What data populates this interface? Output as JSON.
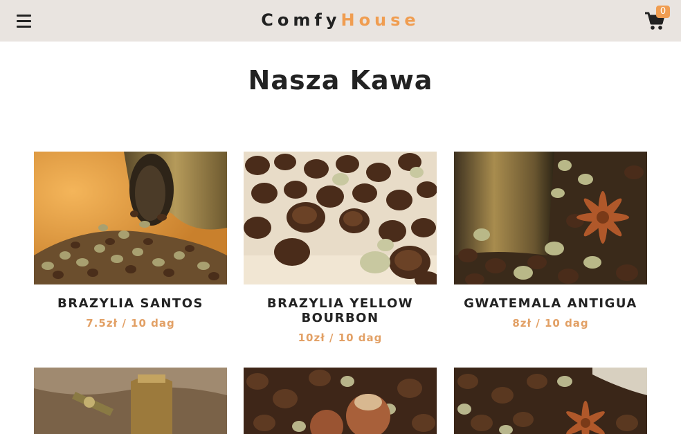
{
  "navbar": {
    "logo_part1": "Comfy",
    "logo_part2": "House",
    "cart_count": "0",
    "menu_icon": "hamburger-menu-icon",
    "cart_icon": "shopping-cart-icon"
  },
  "section": {
    "title": "Nasza Kawa"
  },
  "products": [
    {
      "name": "BRAZYLIA SANTOS",
      "price": "7.5zł / 10 dag"
    },
    {
      "name": "BRAZYLIA YELLOW BOURBON",
      "price": "10zł / 10 dag"
    },
    {
      "name": "GWATEMALA ANTIGUA",
      "price": "8zł / 10 dag"
    }
  ],
  "colors": {
    "accent": "#f09d51",
    "navbar_bg": "#e9e4e0",
    "price": "#e2a065",
    "text": "#222222"
  }
}
